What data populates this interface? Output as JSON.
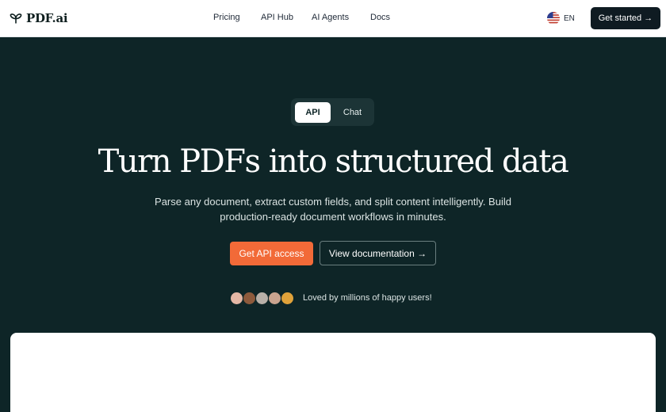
{
  "brand": {
    "name": "PDF.ai"
  },
  "nav": {
    "items": [
      {
        "label": "Pricing"
      },
      {
        "label": "API Hub"
      },
      {
        "label": "AI Agents"
      },
      {
        "label": "Docs"
      }
    ]
  },
  "language": {
    "code": "EN"
  },
  "header": {
    "cta_label": "Get started →"
  },
  "hero": {
    "toggle": {
      "api_label": "API",
      "chat_label": "Chat",
      "selected": "API"
    },
    "title": "Turn PDFs into structured data",
    "subtitle_line1": "Parse any document, extract custom fields, and split content intelligently. Build",
    "subtitle_line2": "production-ready document workflows in minutes.",
    "primary_cta": "Get API access",
    "secondary_cta": "View documentation →",
    "social_proof": "Loved by millions of happy users!"
  },
  "colors": {
    "hero_bg": "#0e2527",
    "accent": "#f26a38",
    "header_cta_bg": "#0f1b22"
  }
}
